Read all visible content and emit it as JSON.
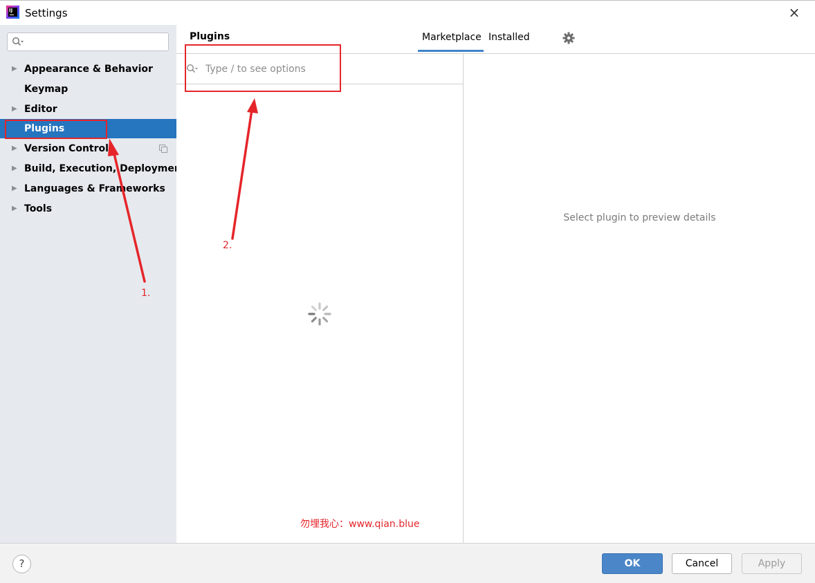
{
  "window": {
    "title": "Settings",
    "close_glyph": "×"
  },
  "sidebar": {
    "search_value": "",
    "items": [
      {
        "label": "Appearance & Behavior",
        "expandable": true
      },
      {
        "label": "Keymap",
        "expandable": false
      },
      {
        "label": "Editor",
        "expandable": true
      },
      {
        "label": "Plugins",
        "expandable": false,
        "selected": true
      },
      {
        "label": "Version Control",
        "expandable": true
      },
      {
        "label": "Build, Execution, Deployment",
        "expandable": true
      },
      {
        "label": "Languages & Frameworks",
        "expandable": true
      },
      {
        "label": "Tools",
        "expandable": true
      }
    ]
  },
  "plugins": {
    "header": "Plugins",
    "tabs": [
      {
        "label": "Marketplace",
        "active": true
      },
      {
        "label": "Installed",
        "active": false
      }
    ],
    "search_placeholder": "Type / to see options",
    "search_value": "",
    "detail_placeholder": "Select plugin to preview details"
  },
  "footer": {
    "help_glyph": "?",
    "ok_label": "OK",
    "cancel_label": "Cancel",
    "apply_label": "Apply",
    "apply_enabled": false
  },
  "annotations": {
    "step1": "1.",
    "step2": "2.",
    "watermark": "勿埋我心：www.qian.blue",
    "color": "#e5252a"
  },
  "icons": [
    "app-logo-icon",
    "search-icon",
    "expand-arrow-icon",
    "copy-icon",
    "gear-icon",
    "loading-spinner-icon",
    "close-icon",
    "help-icon"
  ],
  "colors": {
    "selection": "#2675bf",
    "sidebar_bg": "#e6eaef",
    "tab_underline": "#4083c9",
    "ok_button": "#4a86c8"
  }
}
